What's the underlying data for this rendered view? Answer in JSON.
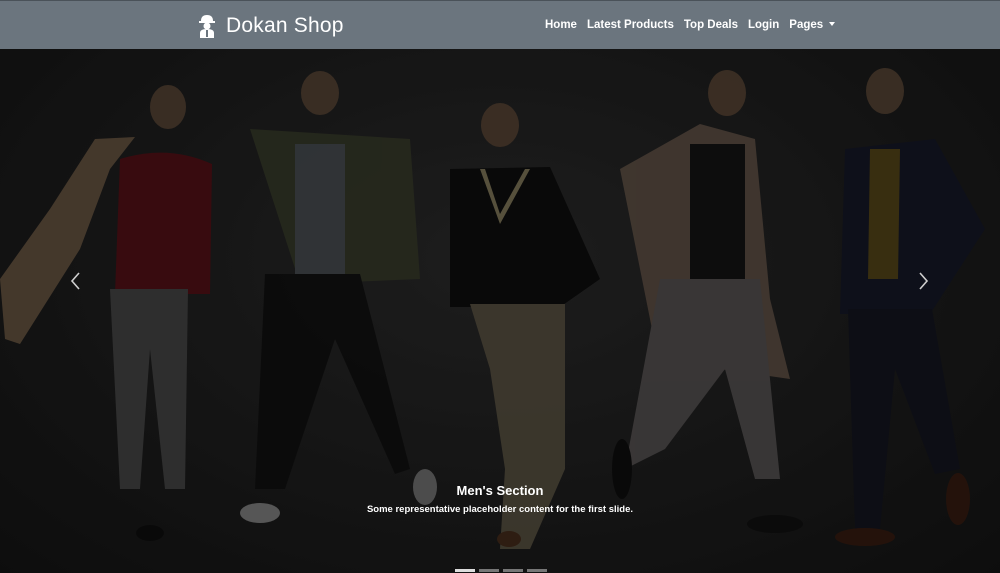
{
  "brand": {
    "name": "Dokan Shop",
    "icon": "shop-owner-icon"
  },
  "nav": {
    "items": [
      {
        "label": "Home"
      },
      {
        "label": "Latest Products"
      },
      {
        "label": "Top Deals"
      },
      {
        "label": "Login"
      },
      {
        "label": "Pages",
        "dropdown": true
      }
    ]
  },
  "carousel": {
    "caption_title": "Men's Section",
    "caption_text": "Some representative placeholder content for the first slide.",
    "slide_count": 4,
    "active_slide": 1,
    "prev_icon": "chevron-left-icon",
    "next_icon": "chevron-right-icon"
  },
  "colors": {
    "navbar": "#6b757e",
    "overlay": "#1b1b1b"
  }
}
